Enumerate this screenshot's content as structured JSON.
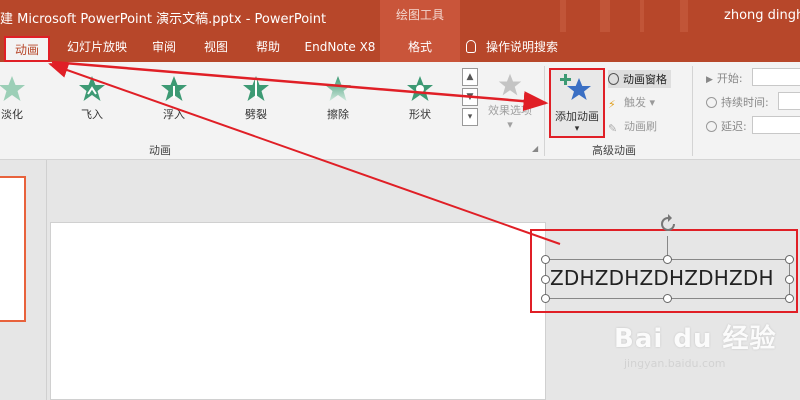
{
  "window": {
    "title": "建 Microsoft PowerPoint 演示文稿.pptx  -  PowerPoint",
    "contextual_group": "绘图工具",
    "user": "zhong dingha"
  },
  "tabs": [
    {
      "label": "动画",
      "active": true
    },
    {
      "label": "幻灯片放映"
    },
    {
      "label": "审阅"
    },
    {
      "label": "视图"
    },
    {
      "label": "帮助"
    },
    {
      "label": "EndNote X8"
    },
    {
      "label": "格式",
      "contextual": true
    }
  ],
  "tell_me": "操作说明搜索",
  "ribbon": {
    "animation_gallery": [
      {
        "label": "淡化",
        "icon": "fade-star-icon"
      },
      {
        "label": "飞入",
        "icon": "fly-in-star-icon"
      },
      {
        "label": "浮入",
        "icon": "float-in-star-icon"
      },
      {
        "label": "劈裂",
        "icon": "split-star-icon"
      },
      {
        "label": "擦除",
        "icon": "wipe-star-icon"
      },
      {
        "label": "形状",
        "icon": "shape-star-icon"
      }
    ],
    "effect_options_lines": [
      "效果选项",
      "▾"
    ],
    "animation_group_label": "动画",
    "add_animation_label": "添加动画",
    "add_animation_arrow": "▾",
    "animation_pane": "动画窗格",
    "trigger": "触发",
    "trigger_arrow": "▾",
    "animation_painter": "动画刷",
    "advanced_group_label": "高级动画",
    "timing": {
      "start": "开始:",
      "duration": "持续时间:",
      "delay": "延迟:"
    }
  },
  "slide": {
    "textbox_text": "ZDHZDHZDHZDHZDH"
  },
  "watermark": {
    "brand": "Bai du 经验",
    "url": "jingyan.baidu.com"
  },
  "colors": {
    "accent": "#b7472a",
    "annotation_red": "#e01f26",
    "star_green": "#3d9a74",
    "star_blue": "#3a6fc4"
  }
}
